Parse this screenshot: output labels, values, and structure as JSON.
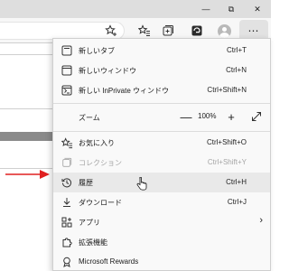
{
  "window": {
    "minimize_glyph": "—",
    "maximize_glyph": "⧉",
    "close_glyph": "✕"
  },
  "toolbar": {
    "more_label": "⋯"
  },
  "menu": {
    "items": [
      {
        "label": "新しいタブ",
        "shortcut": "Ctrl+T",
        "icon": "new-tab-icon"
      },
      {
        "label": "新しいウィンドウ",
        "shortcut": "Ctrl+N",
        "icon": "new-window-icon"
      },
      {
        "label": "新しい InPrivate ウィンドウ",
        "shortcut": "Ctrl+Shift+N",
        "icon": "inprivate-icon"
      },
      {
        "label": "ズーム",
        "icon": ""
      },
      {
        "label": "お気に入り",
        "shortcut": "Ctrl+Shift+O",
        "icon": "favorites-icon"
      },
      {
        "label": "コレクション",
        "shortcut": "Ctrl+Shift+Y",
        "icon": "collections-icon",
        "disabled": true
      },
      {
        "label": "履歴",
        "shortcut": "Ctrl+H",
        "icon": "history-icon"
      },
      {
        "label": "ダウンロード",
        "shortcut": "Ctrl+J",
        "icon": "download-icon"
      },
      {
        "label": "アプリ",
        "icon": "apps-icon"
      },
      {
        "label": "拡張機能",
        "icon": "extensions-icon"
      },
      {
        "label": "Microsoft Rewards",
        "icon": "rewards-icon"
      }
    ],
    "zoom": {
      "minus": "—",
      "value": "100%",
      "plus": "+"
    },
    "submenu_arrow": "›"
  },
  "colors": {
    "accent_arrow": "#e02020",
    "menu_bg": "#f9f9f9",
    "hover_bg": "#e9e9e9",
    "disabled_text": "#a6a6a6"
  }
}
